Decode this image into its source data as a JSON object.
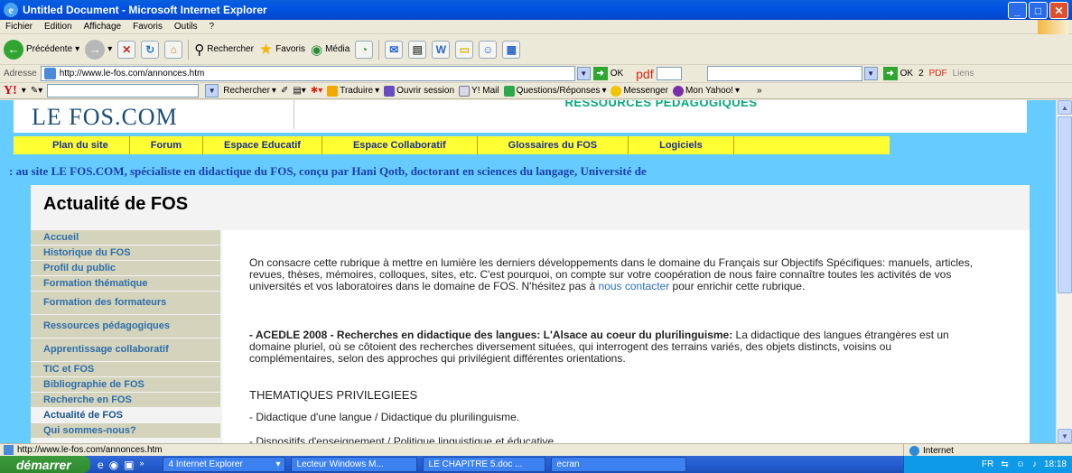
{
  "window": {
    "title": "Untitled Document - Microsoft Internet Explorer"
  },
  "menu": [
    "Fichier",
    "Edition",
    "Affichage",
    "Favoris",
    "Outils",
    "?"
  ],
  "toolbar": {
    "back": "Précédente",
    "search": "Rechercher",
    "favorites": "Favoris",
    "media": "Média"
  },
  "address": {
    "label": "Adresse",
    "url": "http://www.le-fos.com/annonces.htm",
    "ok": "OK",
    "pdf": "pdf",
    "ok2": "OK",
    "count": "2",
    "pdf2": "PDF",
    "links": "Liens"
  },
  "yahoo": {
    "logo": "Y!",
    "search_btn": "Rechercher",
    "translate": "Traduire",
    "open_session": "Ouvrir session",
    "mail": "Y! Mail",
    "qa": "Questions/Réponses",
    "messenger": "Messenger",
    "my_yahoo": "Mon Yahoo!"
  },
  "site": {
    "logo": "LE FOS.COM",
    "banner": "RESSOURCES PÉDAGOGIQUES",
    "nav": [
      "Plan du site",
      "Forum",
      "Espace Educatif",
      "Espace Collaboratif",
      "Glossaires du FOS",
      "Logiciels"
    ],
    "marquee": ": au site LE FOS.COM, spécialiste en didactique du FOS, conçu par Hani Qotb, doctorant en sciences du langage, Université de",
    "page_title": "Actualité de FOS",
    "sidebar": [
      "Accueil",
      "Historique du FOS",
      "Profil du public",
      "Formation thématique",
      "Formation des formateurs",
      "Ressources pédagogiques",
      "Apprentissage collaboratif",
      "TIC et FOS",
      "Bibliographie de FOS",
      "Recherche en FOS",
      "Actualité de FOS",
      "Qui sommes-nous?"
    ],
    "intro_pre": "On consacre cette rubrique à mettre en lumière les derniers développements dans le domaine du Français sur Objectifs Spécifiques: manuels, articles, revues, thèses, mémoires, colloques, sites, etc. C'est pourquoi, on compte sur votre coopération de nous faire connaître toutes les activités de vos universités et vos laboratoires dans le domaine de FOS. N'hésitez pas à ",
    "intro_link": "nous contacter",
    "intro_post": " pour enrichir cette rubrique.",
    "news_bold": "- ACEDLE 2008 - Recherches en didactique des langues: L'Alsace au coeur du plurilinguisme:",
    "news_text": " La didactique des langues étrangères est un domaine pluriel, où se côtoient des recherches diversement situées, qui interrogent des terrains variés, des objets distincts, voisins ou complémentaires, selon des approches qui privilégient différentes orientations.",
    "themes_heading": "THEMATIQUES PRIVILEGIEES",
    "theme1": "- Didactique d'une langue / Didactique du plurilinguisme.",
    "theme2": "- Dispositifs d'enseignement / Politique linguistique et éducative"
  },
  "status": {
    "url": "http://www.le-fos.com/annonces.htm",
    "zone": "Internet"
  },
  "taskbar": {
    "start": "démarrer",
    "tasks": [
      "4 Internet Explorer",
      "Lecteur Windows M...",
      "LE CHAPITRE 5.doc ...",
      "ecran"
    ],
    "lang": "FR",
    "clock": "18:18"
  }
}
